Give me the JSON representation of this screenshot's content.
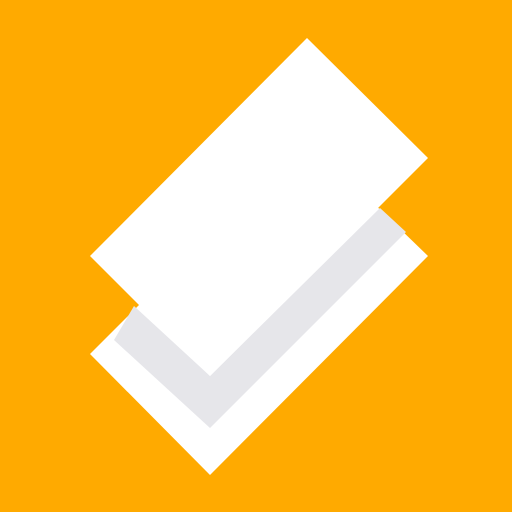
{
  "icon": {
    "name": "stacked-sheets-icon",
    "colors": {
      "background": "#FFAA00",
      "back_sheet": "#FFFFFF",
      "shadow": "#E6E6EA",
      "front_sheet": "#FFFFFF"
    }
  }
}
